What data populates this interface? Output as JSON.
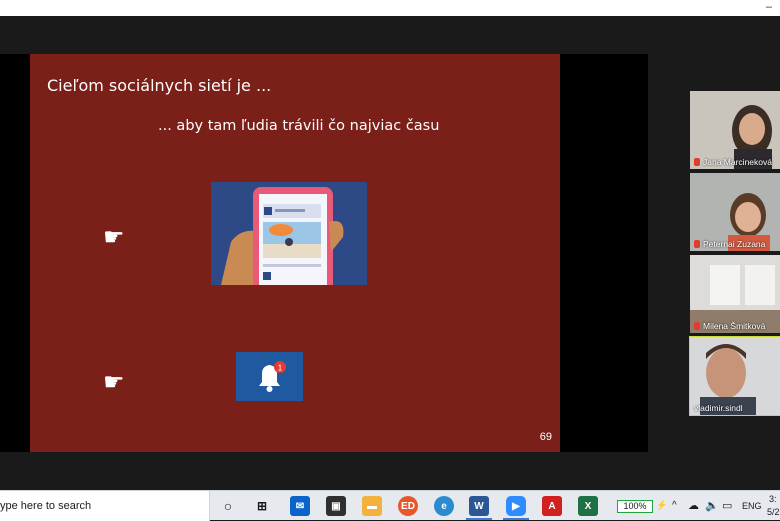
{
  "window": {
    "minimize_glyph": "–"
  },
  "slide": {
    "title": "Cieľom sociálnych sietí je ...",
    "subtitle": "... aby tam ľudia trávili čo najviac času",
    "bullet_icon": "pointing-hand-icon",
    "bullet_glyph": "☛",
    "page_number": "69",
    "bell_badge": "1"
  },
  "participants": [
    {
      "name": "Jana Marcineková",
      "muted": true,
      "active": false
    },
    {
      "name": "Peternai Zuzana",
      "muted": true,
      "active": false
    },
    {
      "name": "Milena Šmitková",
      "muted": true,
      "active": false
    },
    {
      "name": "vladimir.sindl",
      "muted": false,
      "active": true
    }
  ],
  "taskbar": {
    "search_placeholder": "ype here to search",
    "battery": "100%",
    "language": "ENG",
    "clock_time": "3:",
    "clock_date": "5/2"
  },
  "colors": {
    "slide_background": "#7b1f19",
    "active_speaker_border": "#c9dc2f",
    "taskbar": "#e6e9ee"
  }
}
